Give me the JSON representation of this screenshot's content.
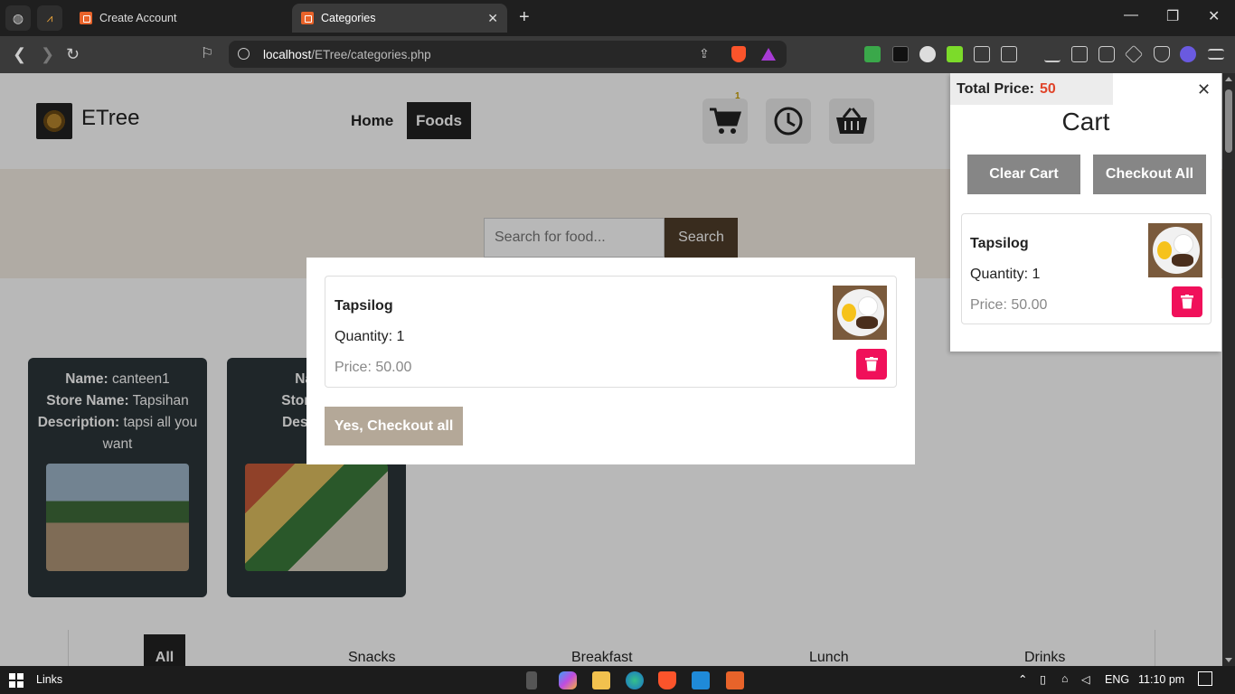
{
  "browser": {
    "tabs": [
      {
        "title": "Create Account",
        "active": false
      },
      {
        "title": "Categories",
        "active": true
      }
    ],
    "url_host": "localhost",
    "url_path": "/ETree/categories.php"
  },
  "header": {
    "logo_text": "ETree",
    "nav": {
      "home": "Home",
      "foods": "Foods"
    },
    "cart_badge": "1"
  },
  "search": {
    "placeholder": "Search for food...",
    "button": "Search"
  },
  "stores": [
    {
      "name_label": "Name:",
      "name": "canteen1",
      "store_label": "Store Name:",
      "store": "Tapsihan",
      "desc_label": "Description:",
      "desc": "tapsi all you want"
    },
    {
      "name_label": "Name:",
      "name": "",
      "store_label": "Store Nam",
      "store": "",
      "desc_label": "Descriptio",
      "desc": ""
    }
  ],
  "categories": [
    "All",
    "Snacks",
    "Breakfast",
    "Lunch",
    "Drinks"
  ],
  "modal": {
    "item": {
      "name": "Tapsilog",
      "quantity": "Quantity: 1",
      "price": "Price: 50.00"
    },
    "confirm_button": "Yes, Checkout all"
  },
  "cart": {
    "total_label": "Total Price:",
    "total_value": "50",
    "title": "Cart",
    "clear_button": "Clear Cart",
    "checkout_button": "Checkout All",
    "item": {
      "name": "Tapsilog",
      "quantity": "Quantity: 1",
      "price": "Price: 50.00"
    }
  },
  "taskbar": {
    "links_label": "Links",
    "language": "ENG",
    "time": "11:10 pm"
  },
  "colors": {
    "accent_red": "#f0105a",
    "total_value": "#e0442a",
    "search_button": "#4f3d2a",
    "store_card": "#2c3539"
  }
}
